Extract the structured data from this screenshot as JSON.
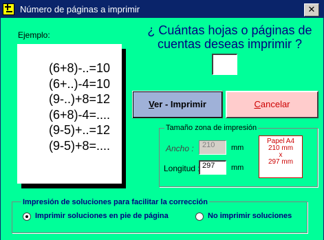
{
  "window": {
    "title": "Número de páginas a imprimir",
    "close_symbol": "✕",
    "icon": "plus-minus-app-icon"
  },
  "example": {
    "label": "Ejemplo:",
    "lines": [
      "(6+8)-..=10",
      "(6+..)-4=10",
      "(9-..)+8=12",
      "(6+8)-4=....",
      "(9-5)+..=12",
      "(9-5)+8=...."
    ]
  },
  "question": {
    "line1": "¿ Cuántas hojas o páginas de",
    "line2": "cuentas deseas imprimir ?",
    "input_value": ""
  },
  "buttons": {
    "ver_first": "V",
    "ver_rest": "er - Imprimir",
    "cancel_first": "C",
    "cancel_rest": "ancelar"
  },
  "print_size": {
    "title": "Tamaño zona de impresión",
    "width_label": "Ancho :",
    "width_value": "210",
    "width_unit": "mm",
    "length_label": "Longitud :",
    "length_value": "297",
    "length_unit": "mm",
    "paper_line1": "Papel A4",
    "paper_line2": "210 mm",
    "paper_line3": "x",
    "paper_line4": "297 mm"
  },
  "solutions": {
    "title": "Impresión de soluciones para facilitar la corrección",
    "option_footer": "Imprimir soluciones en pie de página",
    "option_none": "No imprimir soluciones",
    "selected": "option_footer"
  },
  "colors": {
    "background": "#00ff99",
    "titlebar": "#0a246a",
    "question_text": "#000080",
    "ver_button": "#9fb1d8",
    "cancel_button": "#ffcccc",
    "accent_red": "#cc0000"
  }
}
